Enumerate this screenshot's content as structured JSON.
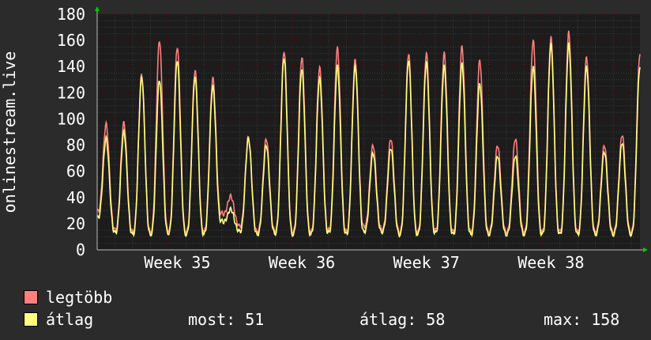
{
  "chart_data": {
    "type": "line",
    "ylabel": "onlinestream.live",
    "y_ticks": [
      0,
      20,
      40,
      60,
      80,
      100,
      120,
      140,
      160,
      180
    ],
    "ylim": [
      0,
      180
    ],
    "x_ticks": [
      "Week 35",
      "Week 36",
      "Week 37",
      "Week 38"
    ],
    "x_unit": "days",
    "xlim": [
      0,
      30.5
    ],
    "grid": true,
    "series": [
      {
        "name": "legtöbb",
        "color": "#ff7f7f",
        "daily_peaks": [
          96,
          97,
          134,
          160,
          155,
          137,
          131,
          41,
          86,
          85,
          152,
          147,
          139,
          154,
          145,
          80,
          85,
          150,
          150,
          150,
          155,
          145,
          80,
          85,
          160,
          162,
          166,
          147,
          80,
          88,
          150
        ],
        "daily_mins": [
          30,
          15,
          14,
          14,
          15,
          14,
          14,
          28,
          18,
          14,
          15,
          14,
          14,
          15,
          14,
          18,
          16,
          14,
          14,
          15,
          14,
          14,
          14,
          14,
          14,
          14,
          14,
          14,
          14,
          14,
          14
        ]
      },
      {
        "name": "átlag",
        "color": "#ffff80",
        "daily_peaks": [
          85,
          90,
          132,
          130,
          145,
          132,
          125,
          31,
          85,
          80,
          147,
          138,
          131,
          140,
          140,
          74,
          78,
          145,
          143,
          140,
          142,
          127,
          72,
          72,
          140,
          157,
          157,
          140,
          75,
          82,
          140
        ],
        "daily_mins": [
          25,
          13,
          12,
          12,
          13,
          12,
          12,
          22,
          14,
          12,
          13,
          12,
          12,
          13,
          12,
          14,
          14,
          12,
          12,
          13,
          12,
          12,
          12,
          12,
          12,
          12,
          12,
          12,
          12,
          12,
          12
        ]
      }
    ]
  },
  "legend": {
    "max_label": "legtöbb",
    "avg_label": "átlag",
    "now_text": "most: 51",
    "avg_text": "átlag: 58",
    "max_text": "max: 158"
  },
  "colors": {
    "background": "#2b2b2b",
    "plot_background": "#1c1c1c",
    "grid_major": "#550000",
    "axis_arrow": "#00cc00"
  }
}
